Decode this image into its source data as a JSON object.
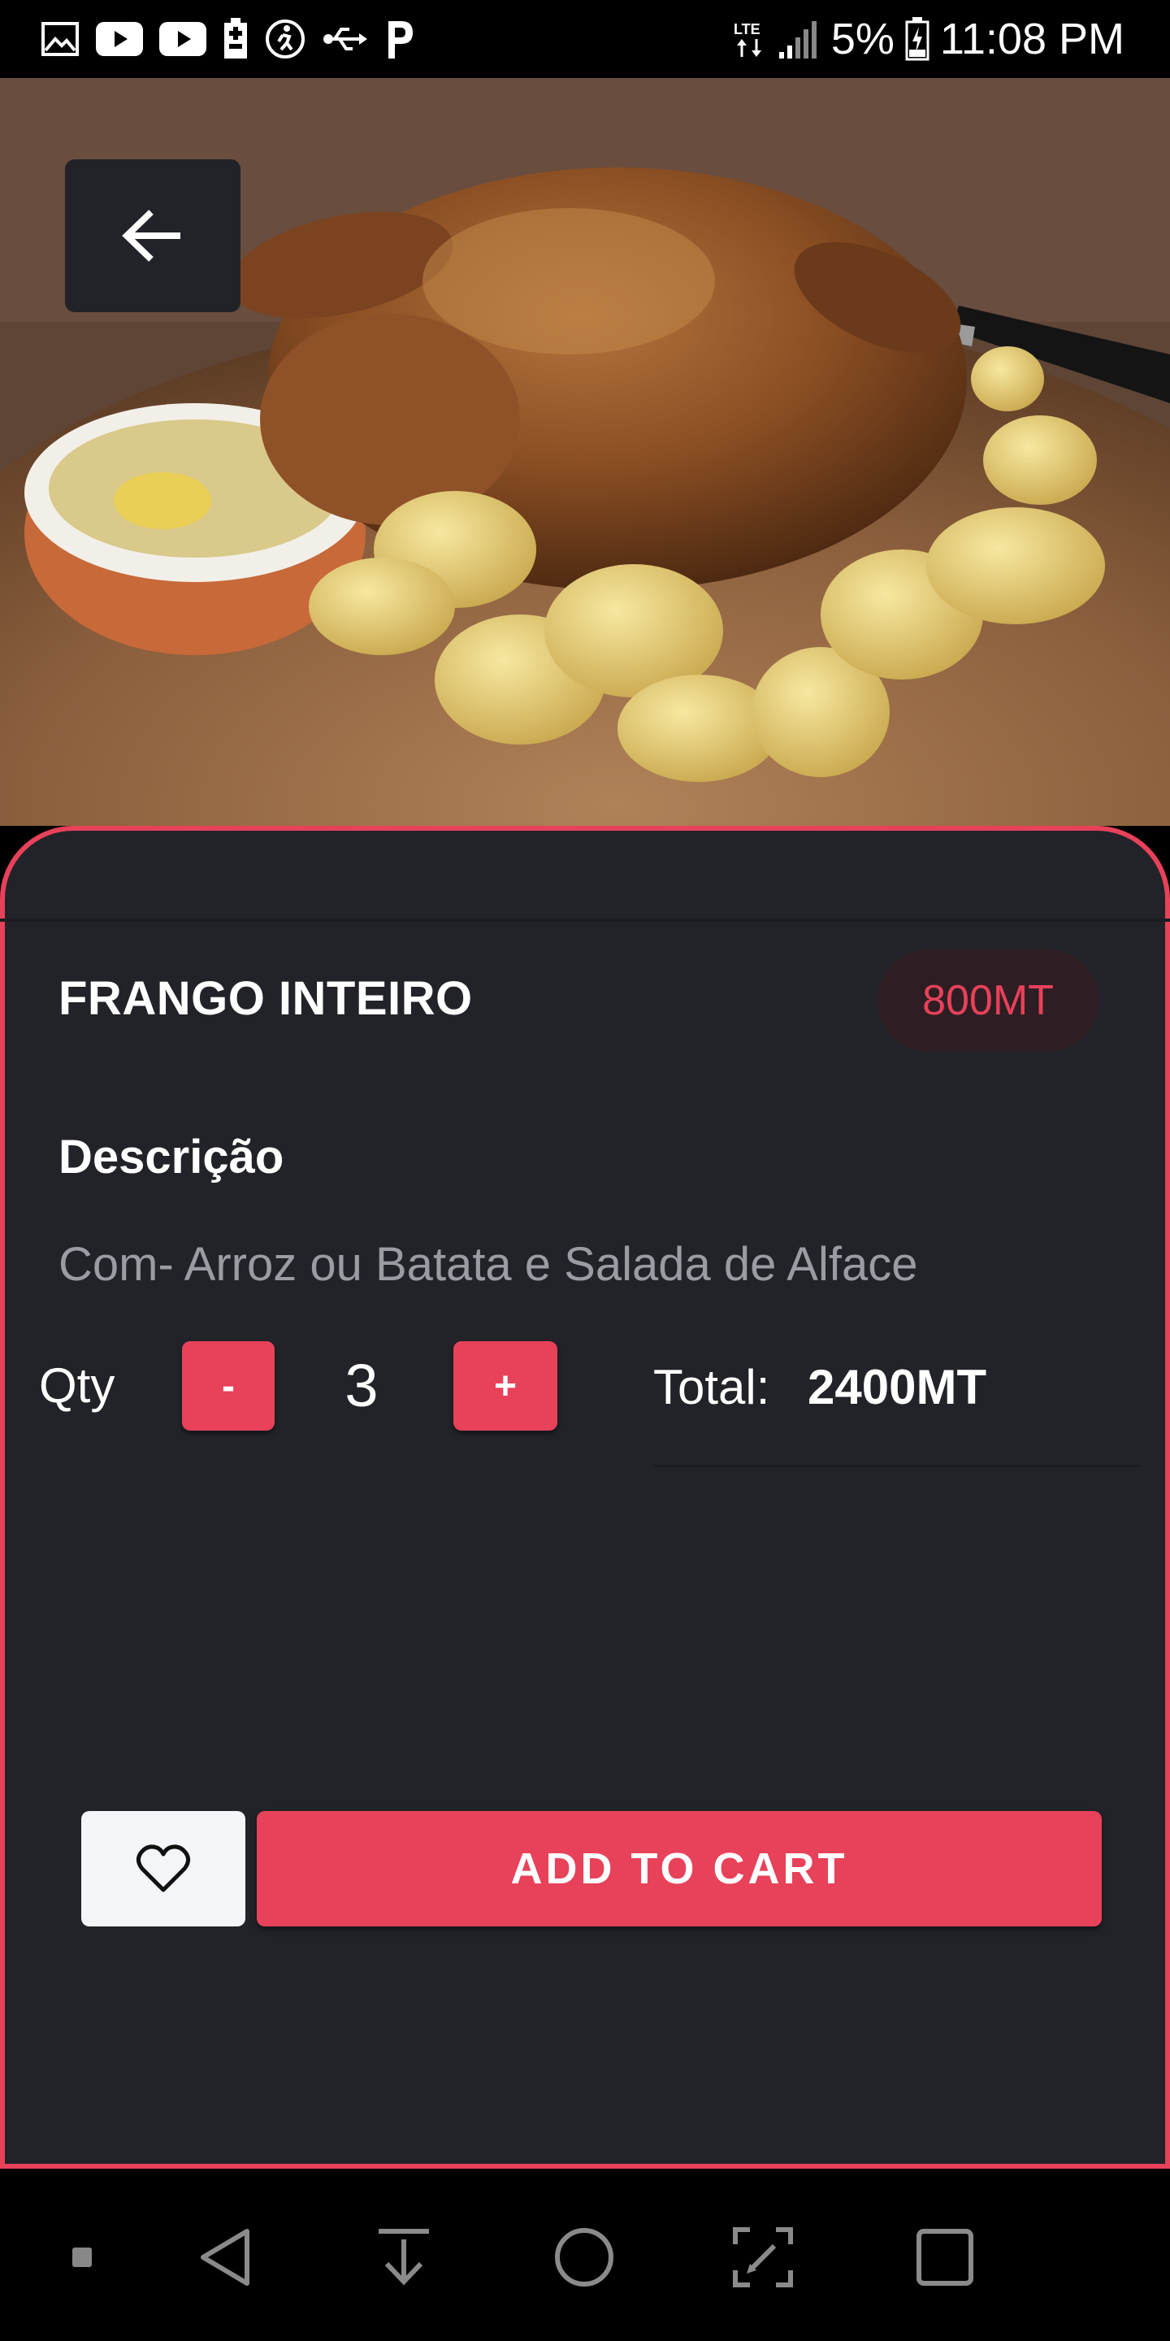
{
  "status_bar": {
    "battery_percent": "5%",
    "time": "11:08 PM",
    "network": "LTE",
    "left_icons": [
      "gallery-icon",
      "youtube-icon",
      "youtube-icon",
      "battery-saver-icon",
      "fitness-icon",
      "usb-icon",
      "p-icon"
    ]
  },
  "hero": {
    "back_icon": "arrow-left-icon"
  },
  "product": {
    "name": "FRANGO INTEIRO",
    "price": "800MT",
    "description_heading": "Descrição",
    "description": "Com- Arroz ou Batata e Salada de Alface"
  },
  "quantity": {
    "label": "Qty",
    "minus_label": "-",
    "plus_label": "+",
    "value": "3"
  },
  "total": {
    "label": "Total:",
    "value": "2400MT"
  },
  "actions": {
    "favorite_icon": "heart-icon",
    "add_to_cart_label": "ADD TO CART"
  },
  "colors": {
    "accent": "#e8415a",
    "panel_bg": "#222328",
    "muted_text": "#9b9ca3",
    "badge_bg": "#2e1e23"
  },
  "nav_bar": {
    "items": [
      "dot-icon",
      "back-triangle-icon",
      "download-icon",
      "home-circle-icon",
      "edit-screenshot-icon",
      "recents-square-icon"
    ]
  }
}
